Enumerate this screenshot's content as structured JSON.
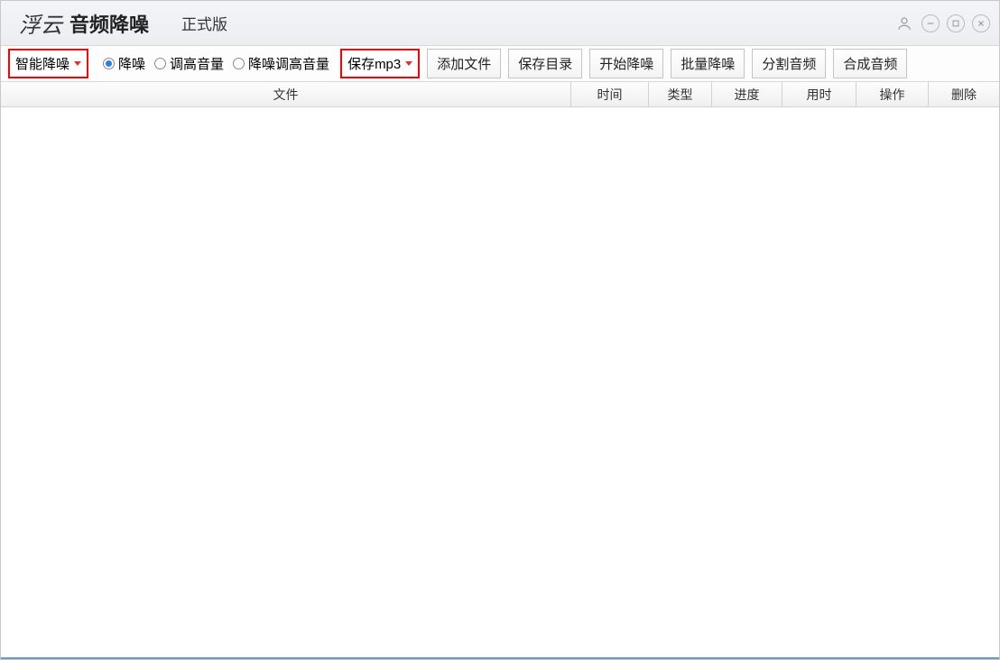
{
  "titlebar": {
    "logo": "浮云",
    "title": "音频降噪",
    "version": "正式版"
  },
  "toolbar": {
    "dropdown_mode": "智能降噪",
    "radios": {
      "r1": "降噪",
      "r2": "调高音量",
      "r3": "降噪调高音量"
    },
    "dropdown_format": "保存mp3",
    "btn_add_file": "添加文件",
    "btn_save_dir": "保存目录",
    "btn_start": "开始降噪",
    "btn_batch": "批量降噪",
    "btn_split": "分割音频",
    "btn_merge": "合成音频"
  },
  "table": {
    "col_file": "文件",
    "col_time": "时间",
    "col_type": "类型",
    "col_progress": "进度",
    "col_duration": "用时",
    "col_action": "操作",
    "col_delete": "删除"
  }
}
